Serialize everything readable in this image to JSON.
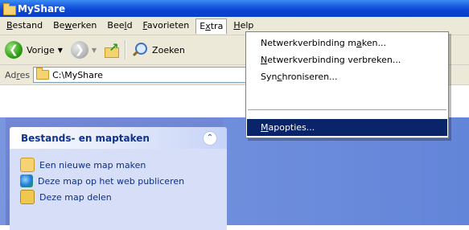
{
  "window": {
    "title": "MyShare"
  },
  "menubar": {
    "items": [
      {
        "pre": "",
        "u": "B",
        "post": "estand"
      },
      {
        "pre": "Be",
        "u": "w",
        "post": "erken"
      },
      {
        "pre": "Bee",
        "u": "l",
        "post": "d"
      },
      {
        "pre": "",
        "u": "F",
        "post": "avorieten"
      },
      {
        "pre": "E",
        "u": "x",
        "post": "tra"
      },
      {
        "pre": "",
        "u": "H",
        "post": "elp"
      }
    ]
  },
  "toolbar": {
    "back_label": "Vorige",
    "search_label": "Zoeken"
  },
  "address": {
    "label_pre": "Ad",
    "label_u": "r",
    "label_post": "es",
    "value": "C:\\MyShare"
  },
  "extra_menu": {
    "items": [
      {
        "pre": "Netwerkverbinding m",
        "u": "a",
        "post": "ken..."
      },
      {
        "pre": "",
        "u": "N",
        "post": "etwerkverbinding verbreken..."
      },
      {
        "pre": "Syn",
        "u": "c",
        "post": "hroniseren..."
      },
      {
        "pre": "",
        "u": "M",
        "post": "apopties..."
      }
    ]
  },
  "task_panel": {
    "title": "Bestands- en maptaken",
    "tasks": [
      "Een nieuwe map maken",
      "Deze map op het web publiceren",
      "Deze map delen"
    ]
  },
  "colors": {
    "titlebar": "#0a46d4",
    "menu_highlight": "#0a246a",
    "chrome": "#ece9d8",
    "task_link": "#0c2f8c"
  }
}
